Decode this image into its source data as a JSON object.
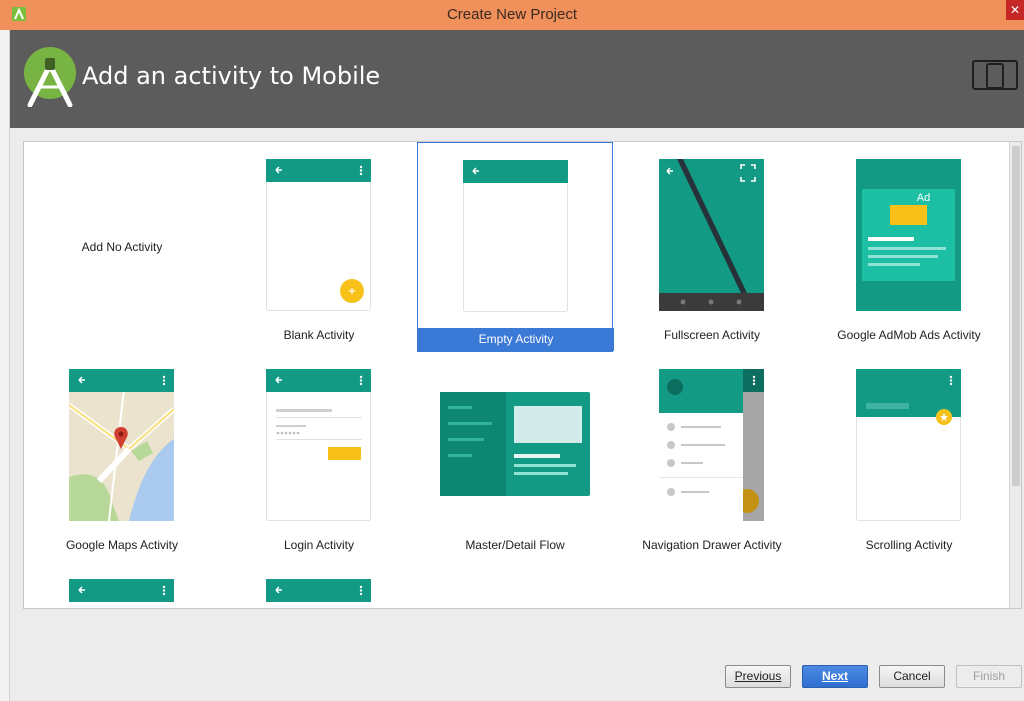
{
  "window": {
    "title": "Create New Project"
  },
  "header": {
    "heading": "Add an activity to Mobile"
  },
  "gallery": {
    "no_activity_label": "Add No Activity",
    "items": [
      {
        "label": "Blank Activity"
      },
      {
        "label": "Empty Activity"
      },
      {
        "label": "Fullscreen Activity"
      },
      {
        "label": "Google AdMob Ads Activity",
        "badge": "Ad"
      },
      {
        "label": "Google Maps Activity"
      },
      {
        "label": "Login Activity"
      },
      {
        "label": "Master/Detail Flow"
      },
      {
        "label": "Navigation Drawer Activity"
      },
      {
        "label": "Scrolling Activity"
      }
    ],
    "selected": "Empty Activity"
  },
  "footer": {
    "previous_label": "Previous",
    "next_label": "Next",
    "cancel_label": "Cancel",
    "finish_label": "Finish"
  },
  "colors": {
    "titlebar": "#f0905a",
    "header": "#5c5c5c",
    "teal": "#129a84",
    "teal_dark": "#0d8672",
    "selection": "#3b79d6",
    "fab": "#f7c11a"
  }
}
